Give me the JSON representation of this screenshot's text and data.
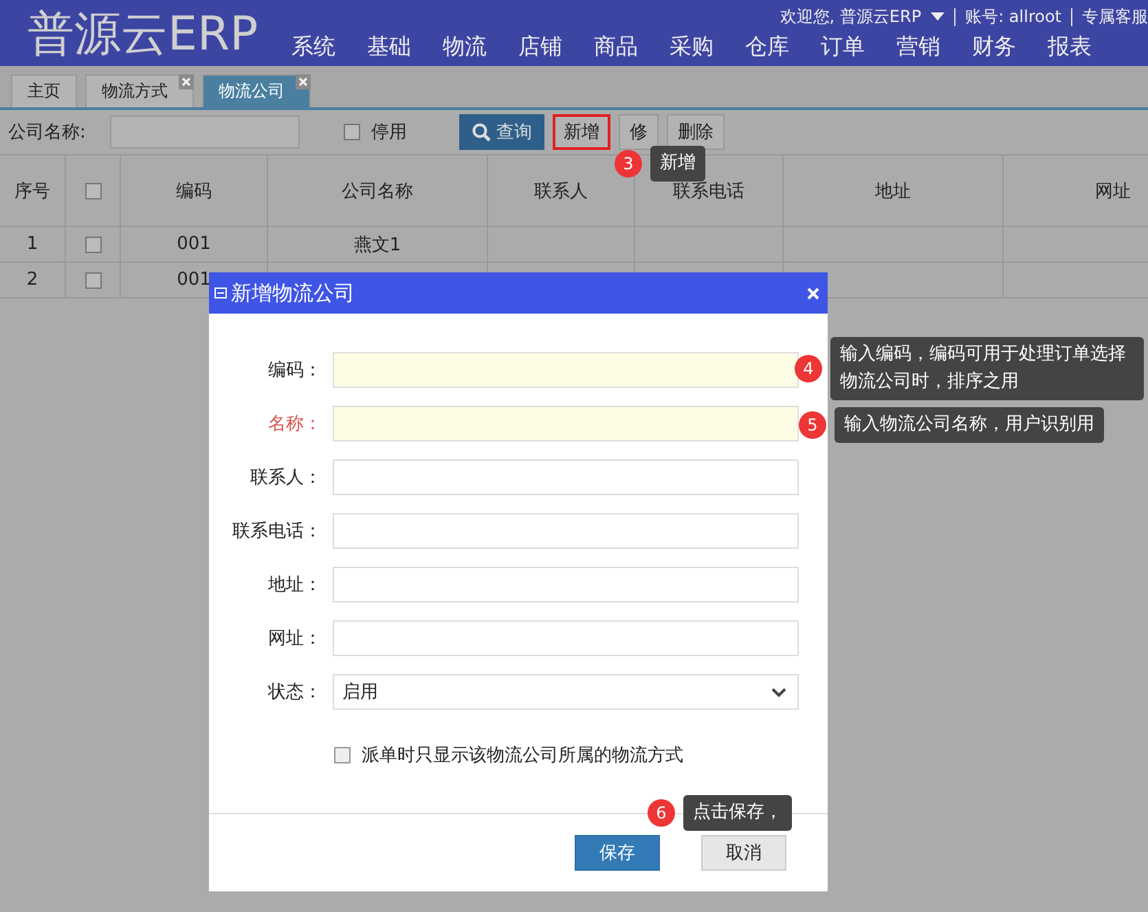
{
  "header": {
    "logo": "普源云ERP",
    "welcome": "欢迎您, 普源云ERP",
    "account": "账号: allroot",
    "service": "专属客服",
    "menu": [
      "系统",
      "基础",
      "物流",
      "店铺",
      "商品",
      "采购",
      "仓库",
      "订单",
      "营销",
      "财务",
      "报表"
    ]
  },
  "tabs": [
    {
      "label": "主页",
      "selected": false,
      "closable": false
    },
    {
      "label": "物流方式",
      "selected": false,
      "closable": true
    },
    {
      "label": "物流公司",
      "selected": true,
      "closable": true
    }
  ],
  "toolbar": {
    "filter_label": "公司名称:",
    "disabled_filter": {
      "label": "停用",
      "checked": false
    },
    "buttons": [
      {
        "label": "查询",
        "kind": "search",
        "highlighted": false
      },
      {
        "label": "新增",
        "kind": "plain",
        "highlighted": true
      },
      {
        "label": "修",
        "kind": "plain",
        "highlighted": false
      },
      {
        "label": "删除",
        "kind": "plain",
        "highlighted": false
      }
    ]
  },
  "table": {
    "columns": [
      {
        "kind": "text",
        "label": "序号"
      },
      {
        "kind": "checkbox",
        "checked": false
      },
      {
        "kind": "text",
        "label": "编码"
      },
      {
        "kind": "text",
        "label": "公司名称"
      },
      {
        "kind": "text",
        "label": "联系人"
      },
      {
        "kind": "text",
        "label": "联系电话"
      },
      {
        "kind": "text",
        "label": "地址"
      },
      {
        "kind": "text",
        "label": "网址"
      }
    ],
    "rows": [
      {
        "index": "1",
        "checked": false,
        "code": "001",
        "name": "燕文1"
      },
      {
        "index": "2",
        "checked": false,
        "code": "001"
      }
    ]
  },
  "dialog": {
    "title": "新增物流公司",
    "fields": [
      {
        "kind": "text",
        "label": "编码：",
        "required": false,
        "highlighted": true
      },
      {
        "kind": "text",
        "label": "名称：",
        "required": true,
        "highlighted": true
      },
      {
        "kind": "text",
        "label": "联系人：",
        "required": false,
        "highlighted": false
      },
      {
        "kind": "text",
        "label": "联系电话：",
        "required": false,
        "highlighted": false
      },
      {
        "kind": "text",
        "label": "地址：",
        "required": false,
        "highlighted": false
      },
      {
        "kind": "text",
        "label": "网址：",
        "required": false,
        "highlighted": false
      },
      {
        "kind": "select",
        "label": "状态：",
        "required": false,
        "value": "启用"
      }
    ],
    "option": {
      "label": "派单时只显示该物流公司所属的物流方式",
      "checked": false
    },
    "buttons": [
      {
        "label": "保存",
        "primary": true
      },
      {
        "label": "取消",
        "primary": false
      }
    ]
  },
  "guide_steps": [
    {
      "number": "3",
      "text": "新增"
    },
    {
      "number": "4",
      "text": "输入编码，编码可用于处理订单选择物流公司时，排序之用"
    },
    {
      "number": "5",
      "text": "输入物流公司名称，用户识别用"
    },
    {
      "number": "6",
      "text": "点击保存，"
    }
  ]
}
